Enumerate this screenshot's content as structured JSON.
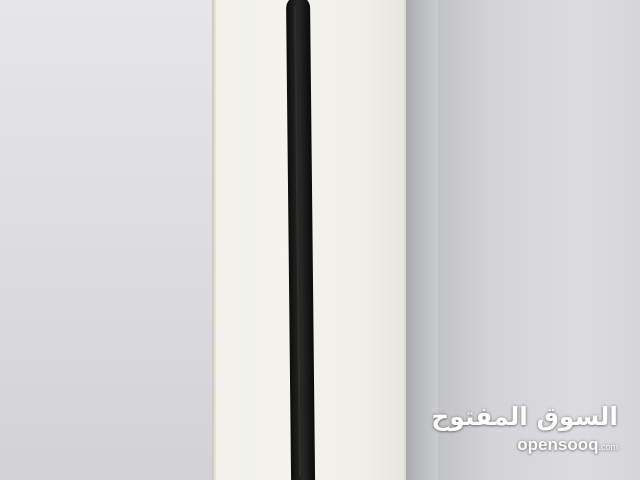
{
  "watermark": {
    "arabic_text": "السوق المفتوح",
    "brand_text": "opensooq",
    "brand_suffix": ".com"
  },
  "colors": {
    "wall": "#dcdcdf",
    "box": "#f2f1eb",
    "stylus": "#1d1f1d",
    "watermark_text": "#ffffff"
  }
}
